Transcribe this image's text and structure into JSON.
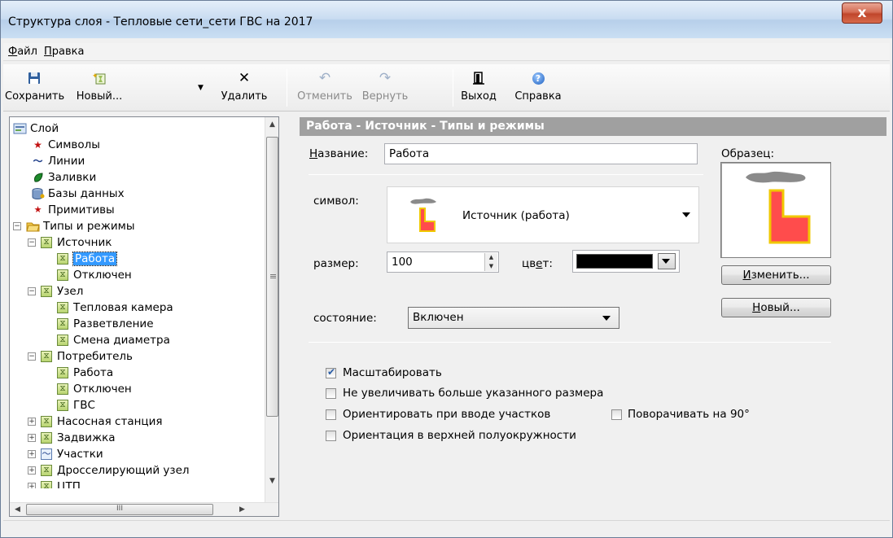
{
  "window": {
    "title": "Структура слоя - Тепловые сети_сети ГВС на 2017",
    "close_glyph": "x"
  },
  "menu": [
    {
      "underline": "Ф",
      "rest": "айл"
    },
    {
      "underline": "П",
      "rest": "равка"
    }
  ],
  "toolbar": {
    "save": {
      "label": "Сохранить",
      "icon": "floppy-disk-icon"
    },
    "new": {
      "label": "Новый...",
      "icon": "new-item-icon"
    },
    "delete": {
      "label": "Удалить",
      "icon": "x-icon",
      "glyph": "✕"
    },
    "undo": {
      "label": "Отменить",
      "icon": "undo-icon",
      "glyph": "↶"
    },
    "redo": {
      "label": "Вернуть",
      "icon": "redo-icon",
      "glyph": "↷"
    },
    "exit": {
      "label": "Выход",
      "icon": "exit-door-icon"
    },
    "help": {
      "label": "Справка",
      "icon": "help-icon",
      "glyph": "?"
    }
  },
  "tree": {
    "items": [
      {
        "label": "Слой",
        "icon": "layer-icon"
      },
      {
        "label": "Символы",
        "icon": "star-icon",
        "glyph": "★"
      },
      {
        "label": "Линии",
        "icon": "wave-line-icon",
        "glyph": "〜"
      },
      {
        "label": "Заливки",
        "icon": "fill-leaf-icon"
      },
      {
        "label": "Базы данных",
        "icon": "database-icon"
      },
      {
        "label": "Примитивы",
        "icon": "primitives-icon",
        "glyph": "★"
      },
      {
        "label": "Типы и режимы",
        "icon": "folder-icon",
        "exp": "−"
      },
      {
        "label": "Источник",
        "exp": "−",
        "glyph": "⧖"
      },
      {
        "label": "Работа",
        "glyph": "⧖"
      },
      {
        "label": "Отключен",
        "glyph": "⧖"
      },
      {
        "label": "Узел",
        "exp": "−",
        "glyph": "⧖"
      },
      {
        "label": "Тепловая камера",
        "glyph": "⧖"
      },
      {
        "label": "Разветвление",
        "glyph": "⧖"
      },
      {
        "label": "Смена диаметра",
        "glyph": "⧖"
      },
      {
        "label": "Потребитель",
        "exp": "−",
        "glyph": "⧖"
      },
      {
        "label": "Работа",
        "glyph": "⧖"
      },
      {
        "label": "Отключен",
        "glyph": "⧖"
      },
      {
        "label": "ГВС",
        "glyph": "⧖"
      },
      {
        "label": "Насосная станция",
        "exp": "+",
        "glyph": "⧖"
      },
      {
        "label": "Задвижка",
        "exp": "+",
        "glyph": "⧖"
      },
      {
        "label": "Участки",
        "exp": "+",
        "glyph": "〜"
      },
      {
        "label": "Дросселирующий узел",
        "exp": "+",
        "glyph": "⧖"
      },
      {
        "label": "ЦТП",
        "exp": "+",
        "glyph": "⧖"
      }
    ],
    "hthumb_glyph": "III"
  },
  "panel": {
    "header": "Работа - Источник - Типы и режимы",
    "name_label_u": "Н",
    "name_label_rest": "азвание:",
    "name_value": "Работа",
    "sample_label": "Образец:",
    "symbol_label": "символ:",
    "symbol_value": "Источник (работа)",
    "size_label": "размер:",
    "size_value": "100",
    "color_label_pre": "цв",
    "color_label_u": "е",
    "color_label_post": "т:",
    "color_value": "#000000",
    "state_label": "состояние:",
    "state_value": "Включен",
    "change_button_u": "И",
    "change_button_rest": "зменить...",
    "new_button_u": "Н",
    "new_button_rest": "овый...",
    "checkboxes": [
      {
        "label": "Масштабировать",
        "checked": true
      },
      {
        "label": "Не увеличивать больше указанного размера",
        "checked": false
      },
      {
        "label": "Ориентировать при вводе участков",
        "checked": false
      },
      {
        "label": "Поворачивать на 90°",
        "checked": false
      },
      {
        "label": "Ориентация в верхней полуокружности",
        "checked": false
      }
    ]
  },
  "colors": {
    "symbol_fill": "#ff4c4c",
    "symbol_outline": "#f0c800",
    "smoke": "#8a8a8a",
    "header_bg": "#a0a0a0",
    "selection": "#3399ff"
  }
}
